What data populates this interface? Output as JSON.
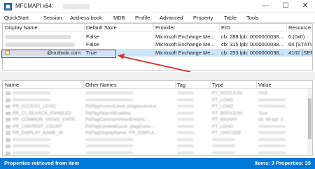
{
  "window": {
    "title": "MFCMAPI x64:",
    "controls": {
      "minimize": "—",
      "maximize": "☐",
      "close": "✕"
    }
  },
  "menu": [
    "QuickStart",
    "Session",
    "Address book",
    "MDB",
    "Profile",
    "Advanced",
    "Property",
    "Table",
    "Tools"
  ],
  "top_table": {
    "columns": [
      "Display Name",
      "Default Store",
      "Provider",
      "EID",
      "Resource"
    ],
    "rows": [
      {
        "display_name": "",
        "default_store": "False",
        "provider": "Microsoft Exchange Me...",
        "eid": "cb: 288 lpb: 0000000038...",
        "resource": "0 (0x0)"
      },
      {
        "display_name": "",
        "default_store": "False",
        "provider": "Microsoft Exchange Me...",
        "eid": "cb: 315 lpb: 0000000038...",
        "resource": "64 (STATU"
      },
      {
        "display_name": "@outlook.com",
        "default_store": "True",
        "provider": "Microsoft Exchange Me...",
        "eid": "cb: 253 lpb: 0000000038...",
        "resource": "4102 (SER"
      }
    ],
    "selected_row": 2
  },
  "annotation": {
    "color": "#d32f2f"
  },
  "bottom_table": {
    "columns": [
      "Name",
      "Other Names",
      "Tag",
      "Type",
      "Value"
    ],
    "rows": [
      {
        "name": "",
        "other": "",
        "tag": "",
        "type": "PT_BOOLEAN",
        "value": "True"
      },
      {
        "name": "",
        "other": "",
        "tag": "",
        "type": "PT_LONG",
        "value": ""
      },
      {
        "name": "PR_ACCESS_LEVEL",
        "other": "PidTagAccessLevel, ptagAccessLe...",
        "tag": "",
        "type": "PT_LONG",
        "value": ""
      },
      {
        "name": "PR_CI_SEARCH_ENABLED",
        "other": "PidTagSearchEnabled",
        "tag": "",
        "type": "PT_BOOLEAN",
        "value": "True"
      },
      {
        "name": "PR_COMMON_VIEWS_ENTR...",
        "other": "PidTagCommonViewsEntryId, ...",
        "tag": "",
        "type": "PT_BINARY",
        "value": "cb: 46 lpb: 0..."
      },
      {
        "name": "PR_CONTENT_COUNT",
        "other": "PidTagContentCount, ptagConte...",
        "tag": "",
        "type": "PT_LONG",
        "value": ""
      },
      {
        "name": "PR_DISPLAY_NAME_W",
        "other": "PidTagDisplayName, PR_DISPLA...",
        "tag": "",
        "type": "PT_UNICODE",
        "value": ""
      },
      {
        "name": "",
        "other": "",
        "tag": "",
        "type": "",
        "value": ""
      },
      {
        "name": "",
        "other": "",
        "tag": "",
        "type": "",
        "value": ""
      },
      {
        "name": "",
        "other": "",
        "tag": "",
        "type": "",
        "value": ""
      }
    ]
  },
  "status": {
    "left": "Properties retrieved from item",
    "right": "Items: 3   Properties: 35"
  }
}
